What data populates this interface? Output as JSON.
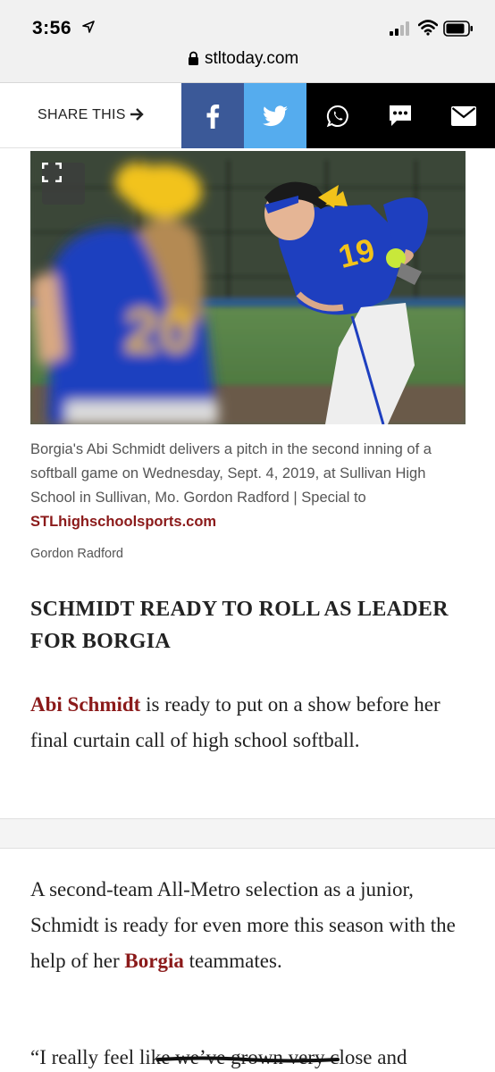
{
  "status_bar": {
    "time": "3:56"
  },
  "browser": {
    "url": "stltoday.com"
  },
  "share": {
    "label": "SHARE THIS",
    "buttons": [
      {
        "name": "facebook",
        "color": "#3b5998"
      },
      {
        "name": "twitter",
        "color": "#55acee"
      },
      {
        "name": "whatsapp",
        "color": "#000000"
      },
      {
        "name": "sms",
        "color": "#000000"
      },
      {
        "name": "email",
        "color": "#000000"
      }
    ]
  },
  "photo": {
    "jersey_number": "19"
  },
  "caption": {
    "text": "Borgia's Abi Schmidt delivers a pitch in the second inning of a softball game on Wednesday, Sept. 4, 2019, at Sullivan High School in Sullivan, Mo. Gordon Radford | Special to ",
    "link": "STLhighschoolsports.com"
  },
  "credit": "Gordon Radford",
  "headline": "SCHMIDT READY TO ROLL AS LEADER FOR BORGIA",
  "paragraphs": {
    "p1_link": "Abi Schmidt",
    "p1_rest": " is ready to put on a show before her final curtain call of high school softball.",
    "p2_start": "A second-team All-Metro selection as a junior, Schmidt is ready for even more this season  with the help of her ",
    "p2_link": "Borgia",
    "p2_end": " teammates.",
    "p3": "“I really feel like we’ve grown very close and"
  },
  "colors": {
    "link": "#8b1a1a",
    "jersey_blue": "#1e3fbf",
    "jersey_gold": "#f2c31a"
  }
}
